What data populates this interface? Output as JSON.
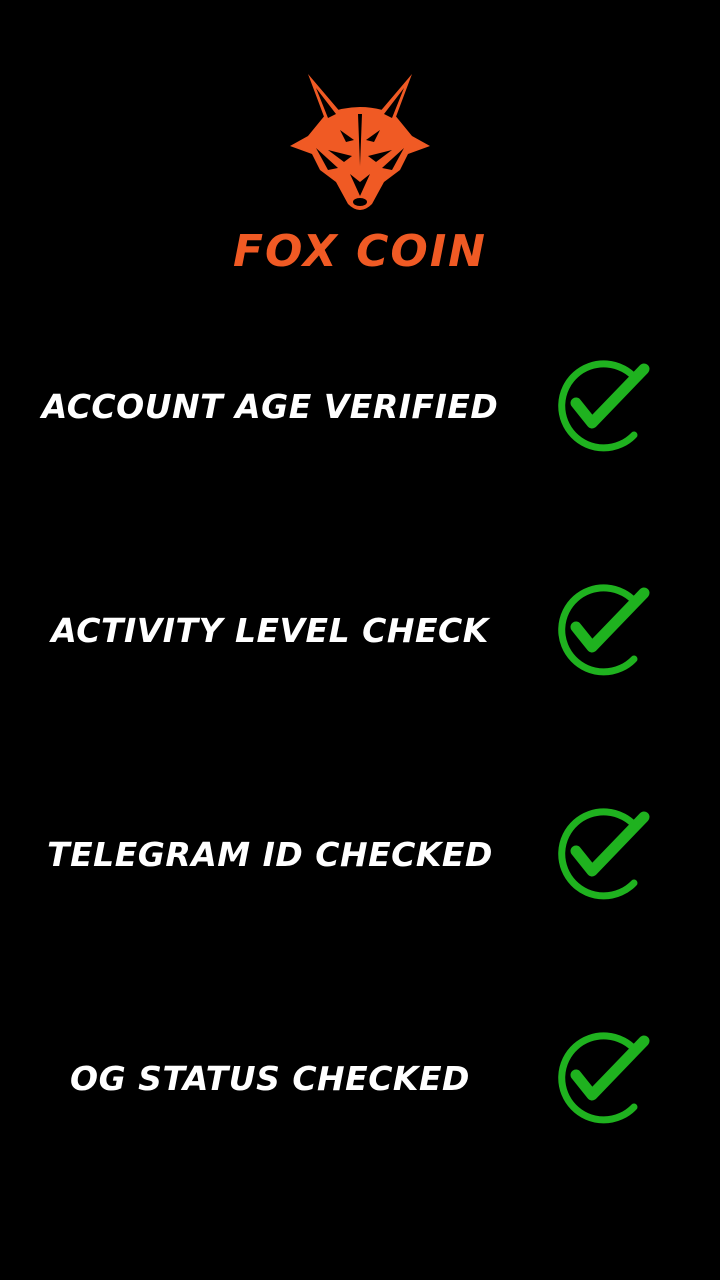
{
  "brand": {
    "name": "FOX COIN",
    "color": "#f05a24",
    "logo_icon": "fox-head-icon"
  },
  "checks": [
    {
      "label": "ACCOUNT AGE VERIFIED",
      "status": "checked",
      "icon": "check-circle-icon"
    },
    {
      "label": "ACTIVITY LEVEL CHECK",
      "status": "checked",
      "icon": "check-circle-icon"
    },
    {
      "label": "TELEGRAM ID CHECKED",
      "status": "checked",
      "icon": "check-circle-icon"
    },
    {
      "label": "OG STATUS CHECKED",
      "status": "checked",
      "icon": "check-circle-icon"
    }
  ],
  "colors": {
    "background": "#000000",
    "text": "#ffffff",
    "check_green": "#1fb21f"
  }
}
